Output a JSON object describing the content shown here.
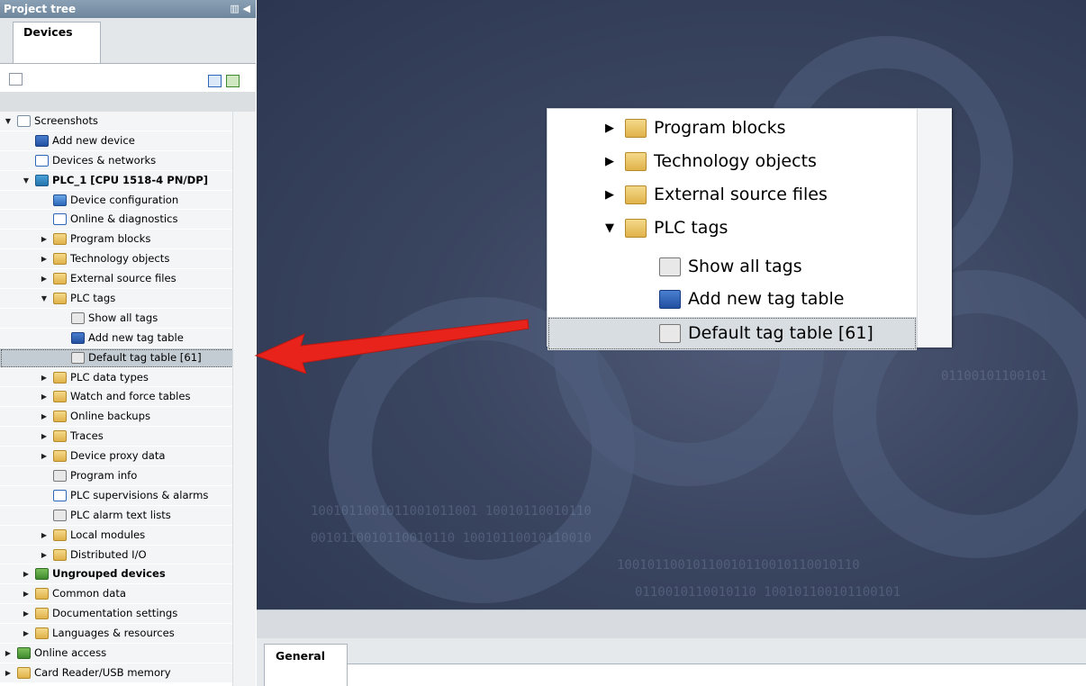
{
  "panel": {
    "title": "Project tree",
    "tab": "Devices"
  },
  "tree": [
    {
      "label": "Screenshots",
      "expander": "▼",
      "icon": "doc",
      "bold": false
    },
    {
      "label": "Add new device",
      "expander": "",
      "icon": "star",
      "bold": false
    },
    {
      "label": "Devices & networks",
      "expander": "",
      "icon": "net",
      "bold": false
    },
    {
      "label": "PLC_1 [CPU 1518-4 PN/DP]",
      "expander": "▼",
      "icon": "plc",
      "bold": true
    },
    {
      "label": "Device configuration",
      "expander": "",
      "icon": "blue",
      "bold": false
    },
    {
      "label": "Online & diagnostics",
      "expander": "",
      "icon": "net",
      "bold": false
    },
    {
      "label": "Program blocks",
      "expander": "▶",
      "icon": "folder",
      "bold": false
    },
    {
      "label": "Technology objects",
      "expander": "▶",
      "icon": "folder",
      "bold": false
    },
    {
      "label": "External source files",
      "expander": "▶",
      "icon": "folder",
      "bold": false
    },
    {
      "label": "PLC tags",
      "expander": "▼",
      "icon": "folder",
      "bold": false
    },
    {
      "label": "Show all tags",
      "expander": "",
      "icon": "grey",
      "bold": false
    },
    {
      "label": "Add new tag table",
      "expander": "",
      "icon": "star",
      "bold": false
    },
    {
      "label": "Default tag table [61]",
      "expander": "",
      "icon": "grey",
      "bold": false,
      "selected": true
    },
    {
      "label": "PLC data types",
      "expander": "▶",
      "icon": "folder",
      "bold": false
    },
    {
      "label": "Watch and force tables",
      "expander": "▶",
      "icon": "folder",
      "bold": false
    },
    {
      "label": "Online backups",
      "expander": "▶",
      "icon": "folder",
      "bold": false
    },
    {
      "label": "Traces",
      "expander": "▶",
      "icon": "folder",
      "bold": false
    },
    {
      "label": "Device proxy data",
      "expander": "▶",
      "icon": "folder",
      "bold": false
    },
    {
      "label": "Program info",
      "expander": "",
      "icon": "grey",
      "bold": false
    },
    {
      "label": "PLC supervisions & alarms",
      "expander": "",
      "icon": "net",
      "bold": false
    },
    {
      "label": "PLC alarm text lists",
      "expander": "",
      "icon": "grey",
      "bold": false
    },
    {
      "label": "Local modules",
      "expander": "▶",
      "icon": "folder",
      "bold": false
    },
    {
      "label": "Distributed I/O",
      "expander": "▶",
      "icon": "folder",
      "bold": false
    },
    {
      "label": "Ungrouped devices",
      "expander": "▶",
      "icon": "green",
      "bold": true
    },
    {
      "label": "Common data",
      "expander": "▶",
      "icon": "folder",
      "bold": false
    },
    {
      "label": "Documentation settings",
      "expander": "▶",
      "icon": "folder",
      "bold": false
    },
    {
      "label": "Languages & resources",
      "expander": "▶",
      "icon": "folder",
      "bold": false
    },
    {
      "label": "Online access",
      "expander": "▶",
      "icon": "green",
      "bold": false
    },
    {
      "label": "Card Reader/USB memory",
      "expander": "▶",
      "icon": "folder",
      "bold": false
    }
  ],
  "zoom": [
    {
      "label": "Program blocks",
      "expander": "▶",
      "icon": "folder"
    },
    {
      "label": "Technology objects",
      "expander": "▶",
      "icon": "folder"
    },
    {
      "label": "External source files",
      "expander": "▶",
      "icon": "folder"
    },
    {
      "label": "PLC tags",
      "expander": "▼",
      "icon": "folder"
    },
    {
      "label": "Show all tags",
      "expander": "",
      "icon": "grey"
    },
    {
      "label": "Add new tag table",
      "expander": "",
      "icon": "star"
    },
    {
      "label": "Default tag table [61]",
      "expander": "",
      "icon": "grey",
      "selected": true
    }
  ],
  "bottom": {
    "tab": "General"
  },
  "colors": {
    "arrow": "#e8231c",
    "header": "#7a90a6",
    "background": "#3a4560"
  }
}
